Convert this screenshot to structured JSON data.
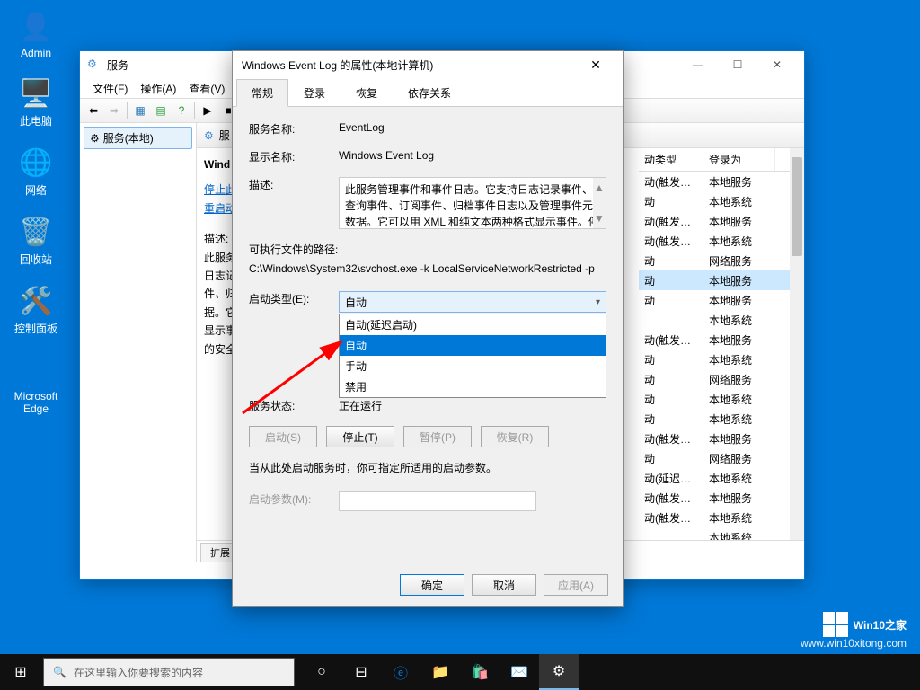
{
  "desktop": {
    "icons": [
      "Admin",
      "此电脑",
      "网络",
      "回收站",
      "控制面板",
      "Microsoft Edge"
    ]
  },
  "taskbar": {
    "search_placeholder": "在这里输入你要搜索的内容"
  },
  "watermark": {
    "brand": "Win10之家",
    "url": "www.win10xitong.com"
  },
  "services_window": {
    "title": "服务",
    "menu": [
      "文件(F)",
      "操作(A)",
      "查看(V)"
    ],
    "tree_node": "服务(本地)",
    "header_label": "服",
    "detail": {
      "name": "Wind",
      "stop_link": "停止此",
      "restart_link": "重启动",
      "desc_label": "描述:",
      "desc_lines": [
        "此服务",
        "日志记",
        "件、归",
        "据。它",
        "显示事",
        "的安全"
      ]
    },
    "columns": {
      "c1": "动类型",
      "c2": "登录为"
    },
    "rows": [
      {
        "c1": "动(触发…",
        "c2": "本地服务"
      },
      {
        "c1": "动",
        "c2": "本地系统"
      },
      {
        "c1": "动(触发…",
        "c2": "本地服务"
      },
      {
        "c1": "动(触发…",
        "c2": "本地系统"
      },
      {
        "c1": "动",
        "c2": "网络服务"
      },
      {
        "c1": "动",
        "c2": "本地服务",
        "sel": true
      },
      {
        "c1": "动",
        "c2": "本地服务"
      },
      {
        "c1": "",
        "c2": "本地系统"
      },
      {
        "c1": "动(触发…",
        "c2": "本地服务"
      },
      {
        "c1": "动",
        "c2": "本地系统"
      },
      {
        "c1": "动",
        "c2": "网络服务"
      },
      {
        "c1": "动",
        "c2": "本地系统"
      },
      {
        "c1": "动",
        "c2": "本地系统"
      },
      {
        "c1": "动(触发…",
        "c2": "本地服务"
      },
      {
        "c1": "动",
        "c2": "网络服务"
      },
      {
        "c1": "动(延迟…",
        "c2": "本地系统"
      },
      {
        "c1": "动(触发…",
        "c2": "本地服务"
      },
      {
        "c1": "动(触发…",
        "c2": "本地系统"
      },
      {
        "c1": "",
        "c2": "本地系统"
      }
    ],
    "bottom_tabs": [
      "扩展"
    ]
  },
  "properties": {
    "title": "Windows Event Log 的属性(本地计算机)",
    "tabs": [
      "常规",
      "登录",
      "恢复",
      "依存关系"
    ],
    "service_name_label": "服务名称:",
    "service_name": "EventLog",
    "display_name_label": "显示名称:",
    "display_name": "Windows Event Log",
    "description_label": "描述:",
    "description": "此服务管理事件和事件日志。它支持日志记录事件、查询事件、订阅事件、归档事件日志以及管理事件元数据。它可以用 XML 和纯文本两种格式显示事件。停止该",
    "exe_path_label": "可执行文件的路径:",
    "exe_path": "C:\\Windows\\System32\\svchost.exe -k LocalServiceNetworkRestricted -p",
    "startup_type_label": "启动类型(E):",
    "startup_type_value": "自动",
    "startup_options": [
      "自动(延迟启动)",
      "自动",
      "手动",
      "禁用"
    ],
    "status_label": "服务状态:",
    "status_value": "正在运行",
    "buttons": {
      "start": "启动(S)",
      "stop": "停止(T)",
      "pause": "暂停(P)",
      "resume": "恢复(R)"
    },
    "hint": "当从此处启动服务时，你可指定所适用的启动参数。",
    "start_params_label": "启动参数(M):",
    "footer": {
      "ok": "确定",
      "cancel": "取消",
      "apply": "应用(A)"
    }
  }
}
